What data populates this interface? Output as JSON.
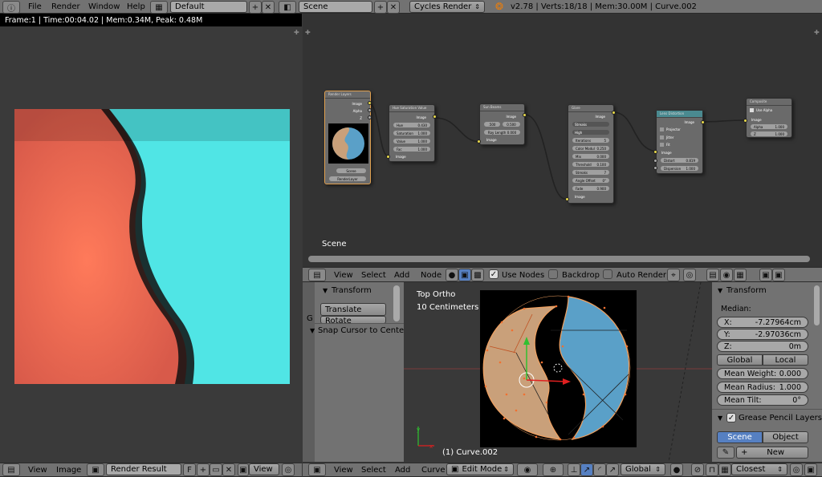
{
  "top": {
    "menus": [
      "File",
      "Render",
      "Window",
      "Help"
    ],
    "layout": "Default",
    "scene": "Scene",
    "engine": "Cycles Render",
    "stats": "v2.78 | Verts:18/18 | Mem:30.00M | Curve.002"
  },
  "image_editor": {
    "info": "Frame:1 | Time:00:04.02 | Mem:0.34M, Peak: 0.48M",
    "menus": [
      "View",
      "Image"
    ],
    "image_name": "Render Result",
    "f_label": "F",
    "view_label": "View"
  },
  "node_editor": {
    "label": "Scene",
    "menus": [
      "View",
      "Select",
      "Add",
      "Node"
    ],
    "use_nodes": "Use Nodes",
    "backdrop": "Backdrop",
    "auto_render": "Auto Render",
    "nodes": {
      "render_layers": {
        "title": "Render Layers",
        "outs": [
          "Image",
          "Alpha",
          "Z"
        ],
        "scene": "Scene",
        "layer": "RenderLayer"
      },
      "hsv": {
        "title": "Hue Saturation Value",
        "out": "Image",
        "fields": [
          [
            "Hue",
            "0.430"
          ],
          [
            "Saturation",
            "1.000"
          ],
          [
            "Value",
            "1.000"
          ],
          [
            "Fac",
            "1.000"
          ]
        ],
        "in": "Image"
      },
      "sunbeams": {
        "title": "Sun Beams",
        "out": "Image",
        "f1": ".500",
        "f2": "0.500",
        "ray": "Ray Length 0.000",
        "in": "Image"
      },
      "glare": {
        "title": "Glare",
        "out": "Image",
        "sel1": "Streaks",
        "sel2": "High",
        "fields": [
          [
            "Iterations",
            "5"
          ],
          [
            "Color Modul",
            "0.250"
          ],
          [
            "Mix",
            "0.000"
          ],
          [
            "Threshold",
            "0.100"
          ],
          [
            "Streaks",
            "7"
          ],
          [
            "Angle Offset",
            "0°"
          ],
          [
            "Fade",
            "0.900"
          ]
        ],
        "in": "Image"
      },
      "lens": {
        "title": "Lens Distortion",
        "out": "Image",
        "opts": [
          "Projector",
          "Jitter",
          "Fit"
        ],
        "in": "Image",
        "distort": "0.819",
        "dispersion": "1.000"
      },
      "composite": {
        "title": "Composite",
        "use_alpha": "Use Alpha",
        "in": "Image",
        "alpha": "1.000",
        "z": "1.000"
      }
    }
  },
  "tool_shelf": {
    "transform_header": "Transform",
    "translate": "Translate",
    "rotate": "Rotate",
    "snap": "Snap Cursor to Center",
    "tab": "G"
  },
  "viewport": {
    "view_name": "Top Ortho",
    "scale": "10 Centimeters",
    "object": "(1) Curve.002"
  },
  "properties": {
    "transform_header": "Transform",
    "median": "Median:",
    "x": {
      "label": "X:",
      "value": "-7.27964cm"
    },
    "y": {
      "label": "Y:",
      "value": "-2.97036cm"
    },
    "z": {
      "label": "Z:",
      "value": "0m"
    },
    "global": "Global",
    "local": "Local",
    "mean_weight": {
      "label": "Mean Weight:",
      "value": "0.000"
    },
    "mean_radius": {
      "label": "Mean Radius:",
      "value": "1.000"
    },
    "mean_tilt": {
      "label": "Mean Tilt:",
      "value": "0°"
    },
    "gp_header": "Grease Pencil Layers",
    "scene_btn": "Scene",
    "object_btn": "Object",
    "new_btn": "New"
  },
  "bottom": {
    "menus": [
      "View",
      "Select",
      "Add",
      "Curve"
    ],
    "mode": "Edit Mode",
    "pivot": "Global",
    "snap": "Closest"
  },
  "colors": {
    "accent": "#5680c2",
    "active_node": "#e0a050",
    "curve_orange": "#f0a060",
    "tan": "#c9a07a",
    "blue": "#5aa0c8"
  }
}
